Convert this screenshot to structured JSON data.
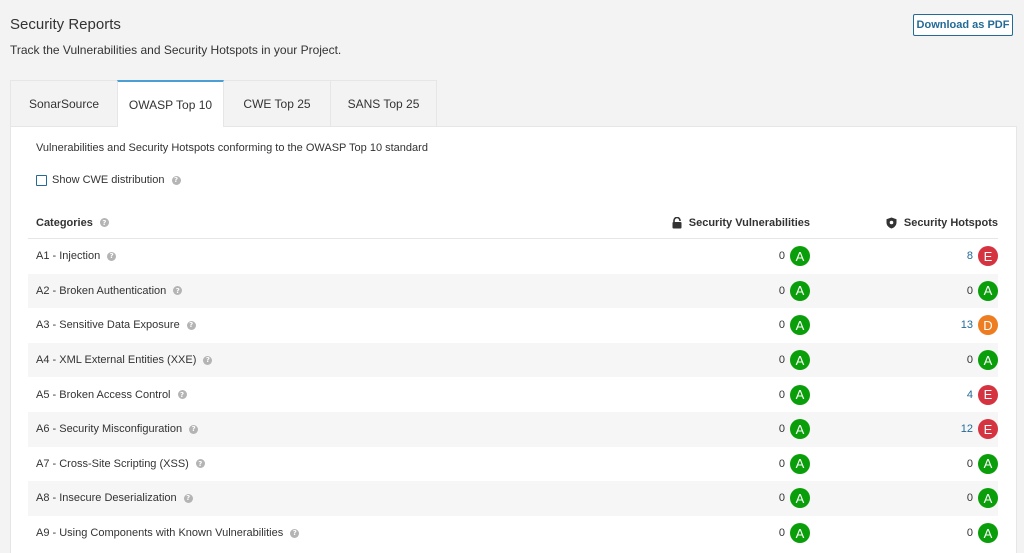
{
  "header": {
    "title": "Security Reports",
    "subtitle": "Track the Vulnerabilities and Security Hotspots in your Project.",
    "download_label": "Download as PDF"
  },
  "tabs": [
    {
      "label": "SonarSource",
      "active": false
    },
    {
      "label": "OWASP Top 10",
      "active": true
    },
    {
      "label": "CWE Top 25",
      "active": false
    },
    {
      "label": "SANS Top 25",
      "active": false
    }
  ],
  "panel": {
    "description": "Vulnerabilities and Security Hotspots conforming to the OWASP Top 10 standard",
    "cwe_toggle_label": "Show CWE distribution",
    "cwe_toggle_checked": false
  },
  "table": {
    "headers": {
      "categories": "Categories",
      "vulnerabilities": "Security Vulnerabilities",
      "hotspots": "Security Hotspots"
    },
    "rows": [
      {
        "category": "A1 - Injection",
        "vuln_count": "0",
        "vuln_rating": "A",
        "hot_count": "8",
        "hot_rating": "E"
      },
      {
        "category": "A2 - Broken Authentication",
        "vuln_count": "0",
        "vuln_rating": "A",
        "hot_count": "0",
        "hot_rating": "A"
      },
      {
        "category": "A3 - Sensitive Data Exposure",
        "vuln_count": "0",
        "vuln_rating": "A",
        "hot_count": "13",
        "hot_rating": "D"
      },
      {
        "category": "A4 - XML External Entities (XXE)",
        "vuln_count": "0",
        "vuln_rating": "A",
        "hot_count": "0",
        "hot_rating": "A"
      },
      {
        "category": "A5 - Broken Access Control",
        "vuln_count": "0",
        "vuln_rating": "A",
        "hot_count": "4",
        "hot_rating": "E"
      },
      {
        "category": "A6 - Security Misconfiguration",
        "vuln_count": "0",
        "vuln_rating": "A",
        "hot_count": "12",
        "hot_rating": "E"
      },
      {
        "category": "A7 - Cross-Site Scripting (XSS)",
        "vuln_count": "0",
        "vuln_rating": "A",
        "hot_count": "0",
        "hot_rating": "A"
      },
      {
        "category": "A8 - Insecure Deserialization",
        "vuln_count": "0",
        "vuln_rating": "A",
        "hot_count": "0",
        "hot_rating": "A"
      },
      {
        "category": "A9 - Using Components with Known Vulnerabilities",
        "vuln_count": "0",
        "vuln_rating": "A",
        "hot_count": "0",
        "hot_rating": "A"
      }
    ]
  },
  "rating_colors": {
    "A": "#0a9e0a",
    "B": "#b0d513",
    "C": "#eabe06",
    "D": "#ed7d20",
    "E": "#d4333f"
  },
  "icons": {
    "help": "help-icon",
    "vulnerabilities": "lock-icon",
    "hotspots": "shield-icon"
  }
}
